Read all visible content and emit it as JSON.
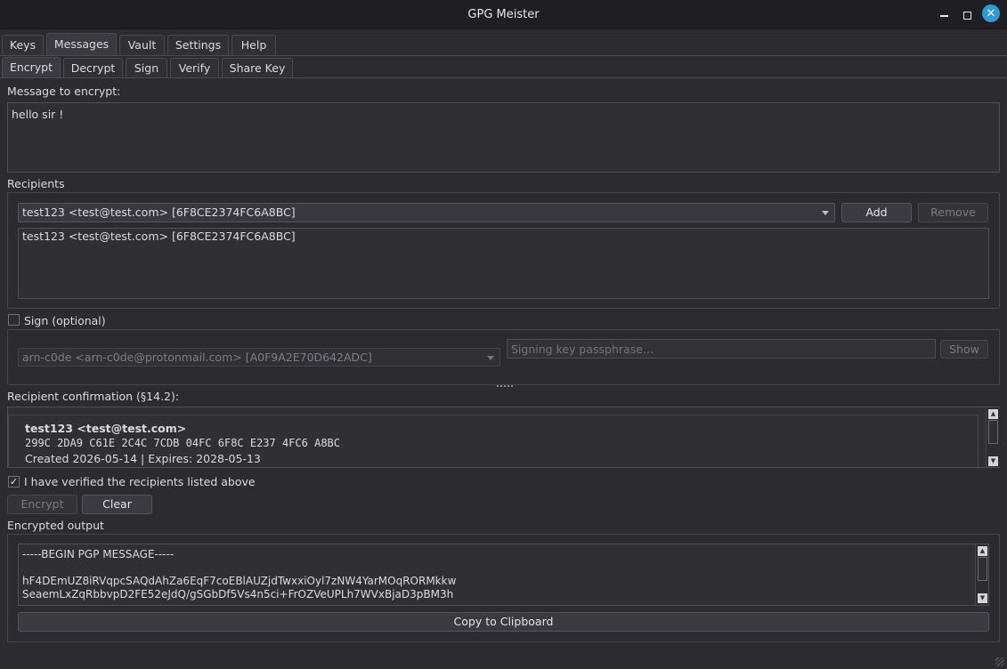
{
  "window": {
    "title": "GPG Meister"
  },
  "tabs": [
    {
      "label": "Keys"
    },
    {
      "label": "Messages"
    },
    {
      "label": "Vault"
    },
    {
      "label": "Settings"
    },
    {
      "label": "Help"
    }
  ],
  "subtabs": [
    {
      "label": "Encrypt"
    },
    {
      "label": "Decrypt"
    },
    {
      "label": "Sign"
    },
    {
      "label": "Verify"
    },
    {
      "label": "Share Key"
    }
  ],
  "message": {
    "label": "Message to encrypt:",
    "value": "hello sir !"
  },
  "recipients": {
    "label": "Recipients",
    "selected": "test123 <test@test.com>  [6F8CE2374FC6A8BC]",
    "add_label": "Add",
    "remove_label": "Remove",
    "list": [
      "test123 <test@test.com>  [6F8CE2374FC6A8BC]"
    ]
  },
  "sign": {
    "label": "Sign (optional)",
    "key": "arn-c0de <arn-c0de@protonmail.com>  [A0F9A2E70D642ADC]",
    "passphrase_placeholder": "Signing key passphrase…",
    "show_label": "Show"
  },
  "confirmation": {
    "label": "Recipient confirmation (§14.2):",
    "name": "test123 <test@test.com>",
    "fingerprint": "299C 2DA9 C61E 2C4C 7CDB 04FC 6F8C E237 4FC6 A8BC",
    "dates": "Created 2026-05-14 | Expires: 2028-05-13",
    "verified_label": "I have verified the recipients listed above"
  },
  "actions": {
    "encrypt_label": "Encrypt",
    "clear_label": "Clear"
  },
  "output": {
    "label": "Encrypted output",
    "line1": "-----BEGIN PGP MESSAGE-----",
    "line2": "hF4DEmUZ8iRVqpcSAQdAhZa6EqF7coEBlAUZjdTwxxiOyl7zNW4YarMOqRORMkkw",
    "line3": "SeaemLxZqRbbvpD2FE52eJdQ/gSGbDf5Vs4n5ci+FrOZVeUPLh7WVxBjaD3pBM3h",
    "copy_label": "Copy to Clipboard"
  },
  "colors": {
    "accent": "#2e9bd6",
    "background": "#2b2b30",
    "titlebar": "#1f1f22"
  }
}
